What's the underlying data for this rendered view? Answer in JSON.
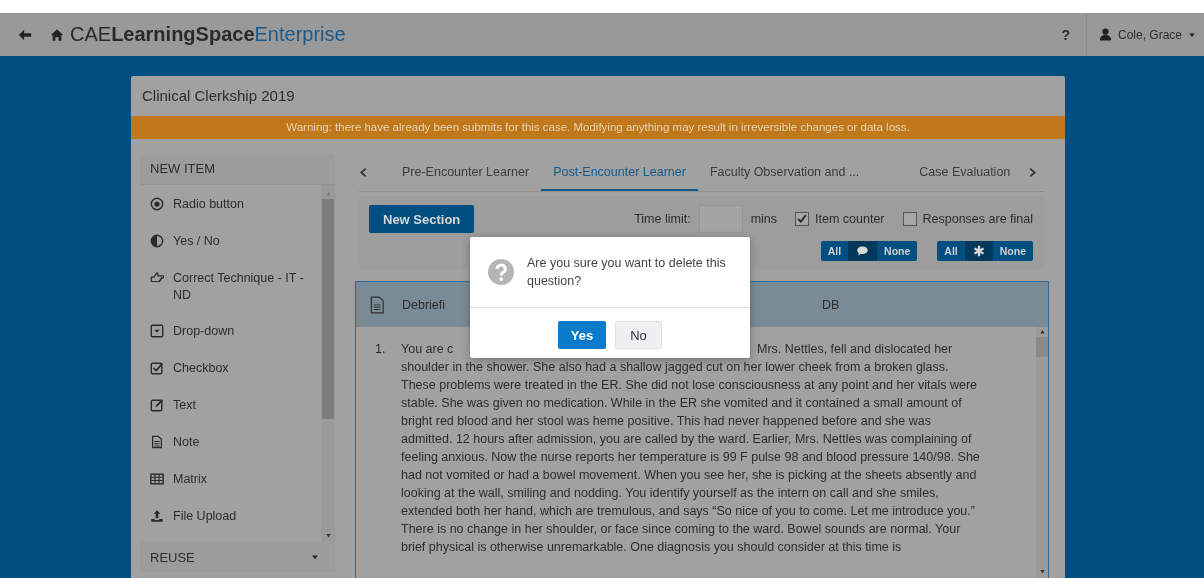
{
  "header": {
    "logo": [
      {
        "text": "CAE",
        "kind": "light"
      },
      {
        "text": "LearningSpace",
        "kind": "bold"
      },
      {
        "text": "Enterprise",
        "kind": "accent"
      }
    ],
    "help": "?",
    "user": "Cole, Grace"
  },
  "page": {
    "title": "Clinical Clerkship 2019",
    "warning": "Warning: there have already been submits for this case. Modifying anything may result in irreversible changes or data loss."
  },
  "sidebar": {
    "heading": "NEW ITEM",
    "items": [
      {
        "label": "Radio button",
        "kind": "radio"
      },
      {
        "label": "Yes / No",
        "kind": "yesno"
      },
      {
        "label": "Correct Technique - IT - ND",
        "kind": "hand"
      },
      {
        "label": "Drop-down",
        "kind": "dropdown"
      },
      {
        "label": "Checkbox",
        "kind": "checkbox"
      },
      {
        "label": "Text",
        "kind": "text"
      },
      {
        "label": "Note",
        "kind": "note"
      },
      {
        "label": "Matrix",
        "kind": "matrix"
      },
      {
        "label": "File Upload",
        "kind": "upload"
      }
    ],
    "footer": "REUSE"
  },
  "tabs": [
    {
      "label": "Pre-Encounter Learner",
      "selected": false
    },
    {
      "label": "Post-Encounter Learner",
      "selected": true
    },
    {
      "label": "Faculty Observation and ...",
      "selected": false
    },
    {
      "label": "Case Evaluation",
      "selected": false
    }
  ],
  "toolbar": {
    "button": "New Section",
    "time_label": "Time limit:",
    "unit": "mins",
    "checkboxes": [
      {
        "label": "Item counter",
        "checked": true
      },
      {
        "label": "Responses are final",
        "checked": false
      }
    ],
    "toggles": [
      {
        "all": "All",
        "none": "None",
        "kind": "comment"
      },
      {
        "all": "All",
        "none": "None",
        "kind": "asterisk"
      }
    ]
  },
  "card": {
    "title": "Debriefi",
    "column_2": "DB",
    "number": "1.",
    "text_start": "You are c",
    "text_resume": "Mrs. Nettles, fell and dislocated her",
    "text": "shoulder in the shower. She also had a shallow jagged cut on her lower cheek from a broken glass. These problems were treated in the ER. She did not lose consciousness at any point and her vitals were stable. She was given no medication. While in the ER she vomited and it contained a small amount of bright red blood and her stool was heme positive. This had never happened before and she was admitted. 12 hours after admission, you are called by the ward. Earlier, Mrs. Nettles was complaining of feeling anxious. Now the nurse reports her temperature is 99 F pulse 98 and blood pressure 140/98. She had not vomited or had a bowel movement. When you see her, she is picking at the sheets absently and looking at the wall, smiling and nodding. You identify yourself as the intern on call and she smiles, extended both her hand, which are tremulous, and says “So nice of you to come. Let me introduce you.” There is no change in her shoulder, or face since coming to the ward. Bowel sounds are normal. Your brief physical is otherwise unremarkable. One diagnosis you should consider at this time is"
  },
  "dialog": {
    "message": "Are you sure you want to delete this question?",
    "buttons": [
      {
        "label": "Yes",
        "kind": "primary"
      },
      {
        "label": "No",
        "kind": "default"
      }
    ]
  }
}
